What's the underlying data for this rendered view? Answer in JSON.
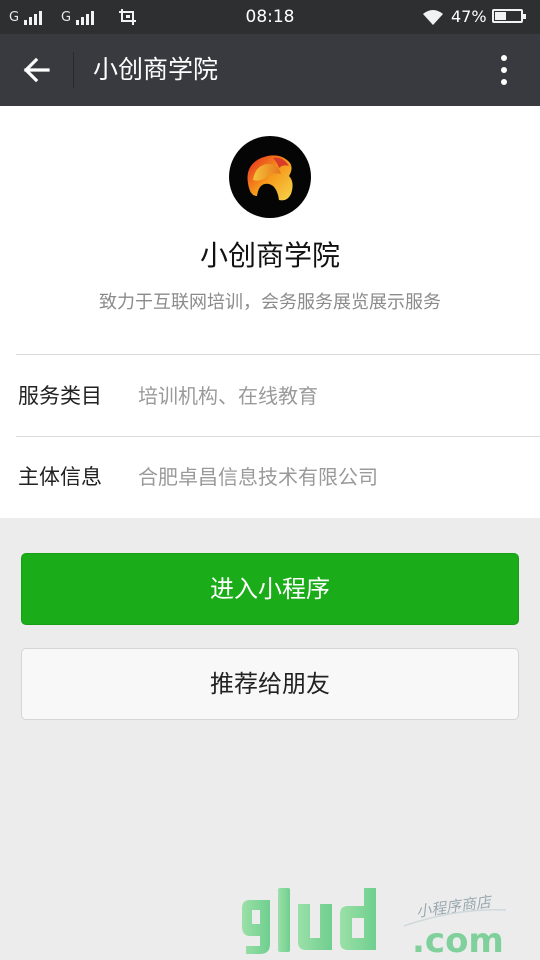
{
  "status_bar": {
    "network_1": "G",
    "network_2": "G",
    "time": "08:18",
    "battery_percent": "47%",
    "battery_level": 0.47
  },
  "title_bar": {
    "title": "小创商学院"
  },
  "profile": {
    "name": "小创商学院",
    "description": "致力于互联网培训，会务服务展览展示服务"
  },
  "info_rows": [
    {
      "label": "服务类目",
      "value": "培训机构、在线教育"
    },
    {
      "label": "主体信息",
      "value": "合肥卓昌信息技术有限公司"
    }
  ],
  "buttons": {
    "enter": "进入小程序",
    "share": "推荐给朋友"
  },
  "watermark": {
    "brand": "9lud",
    "domain": ".com",
    "tagline": "小程序商店"
  },
  "colors": {
    "primary_green": "#1aad19",
    "title_bar_bg": "#393a3f",
    "status_bar_bg": "#2e2f31"
  }
}
